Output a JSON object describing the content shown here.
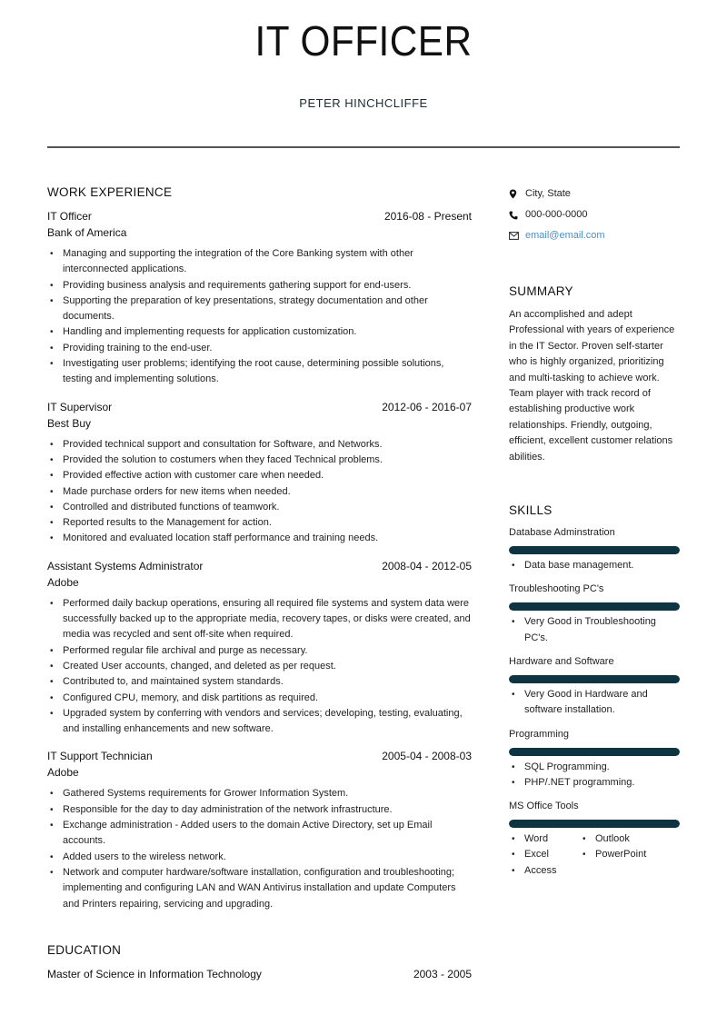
{
  "header": {
    "title": "IT OFFICER",
    "name": "PETER HINCHCLIFFE"
  },
  "work": {
    "section_title": "WORK EXPERIENCE",
    "jobs": [
      {
        "role": "IT Officer",
        "dates": "2016-08 - Present",
        "company": "Bank of America",
        "bullets": [
          "Managing and supporting the integration of the Core Banking system with other interconnected applications.",
          "Providing business analysis and requirements gathering support for end-users.",
          "Supporting the preparation of key presentations, strategy documentation and other documents.",
          "Handling and implementing requests for application customization.",
          "Providing training to the end-user.",
          "Investigating user problems; identifying the root cause, determining possible solutions, testing and implementing solutions."
        ]
      },
      {
        "role": "IT Supervisor",
        "dates": "2012-06 - 2016-07",
        "company": "Best Buy",
        "bullets": [
          "Provided technical support and consultation for Software, and Networks.",
          "Provided the solution to costumers when they faced Technical problems.",
          "Provided effective action with customer care when needed.",
          "Made purchase orders for new items when needed.",
          "Controlled and distributed functions of teamwork.",
          "Reported results to the Management for action.",
          "Monitored and evaluated location staff performance and training needs."
        ]
      },
      {
        "role": "Assistant Systems Administrator",
        "dates": "2008-04 - 2012-05",
        "company": "Adobe",
        "bullets": [
          "Performed daily backup operations, ensuring all required file systems and system data were successfully backed up to the appropriate media, recovery tapes, or disks were created, and media was recycled and sent off-site when required.",
          "Performed regular file archival and purge as necessary.",
          "Created User accounts, changed, and deleted as per request.",
          "Contributed to, and maintained system standards.",
          "Configured CPU, memory, and disk partitions as required.",
          "Upgraded system by conferring with vendors and services; developing, testing, evaluating, and installing enhancements and new software."
        ]
      },
      {
        "role": "IT Support Technician",
        "dates": "2005-04 - 2008-03",
        "company": "Adobe",
        "bullets": [
          "Gathered Systems requirements for Grower Information System.",
          "Responsible for the day to day administration of the network infrastructure.",
          "Exchange administration - Added users to the domain Active Directory, set up Email accounts.",
          "Added users to the wireless network.",
          "Network and computer hardware/software installation, configuration and troubleshooting; implementing and configuring LAN and WAN Antivirus installation and update Computers and Printers repairing, servicing and upgrading."
        ]
      }
    ]
  },
  "education": {
    "section_title": "EDUCATION",
    "items": [
      {
        "degree": "Master of Science in Information Technology",
        "dates": "2003 - 2005"
      }
    ]
  },
  "contact": {
    "location": "City, State",
    "location_icon": "map-pin-icon",
    "phone": "000-000-0000",
    "phone_icon": "phone-icon",
    "email": "email@email.com",
    "email_icon": "envelope-icon",
    "link_color": "#4a90c8"
  },
  "summary": {
    "section_title": "SUMMARY",
    "text": "An accomplished and adept Professional with years of experience in the IT Sector. Proven self-starter who is highly organized, prioritizing and multi-tasking to achieve work. Team player with track record of establishing productive work relationships. Friendly, outgoing, efficient, excellent customer relations abilities."
  },
  "skills": {
    "section_title": "SKILLS",
    "bar_color": "#0d3440",
    "items": [
      {
        "name": "Database Adminstration",
        "level": 1.0,
        "bullets": [
          "Data base management."
        ]
      },
      {
        "name": "Troubleshooting PC's",
        "level": 1.0,
        "bullets": [
          "Very Good in Troubleshooting PC's."
        ]
      },
      {
        "name": "Hardware and Software",
        "level": 1.0,
        "bullets": [
          "Very Good in Hardware and software installation."
        ]
      },
      {
        "name": "Programming",
        "level": 1.0,
        "bullets": [
          "SQL Programming.",
          "PHP/.NET programming."
        ]
      },
      {
        "name": "MS Office Tools",
        "level": 1.0,
        "bullets_col1": [
          "Word",
          "Excel",
          "Access"
        ],
        "bullets_col2": [
          "Outlook",
          "PowerPoint"
        ]
      }
    ]
  }
}
